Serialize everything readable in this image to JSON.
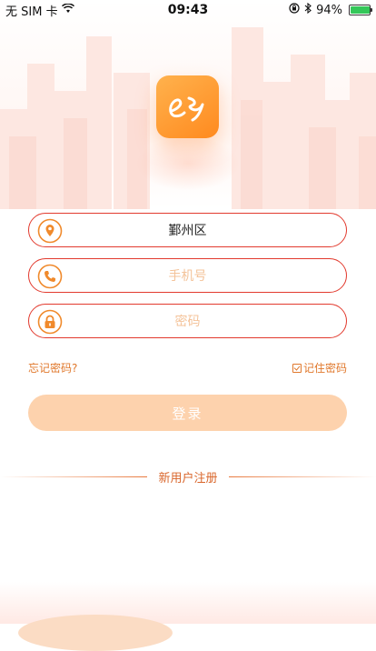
{
  "status_bar": {
    "carrier": "无 SIM 卡",
    "time": "09:43",
    "battery_percent": "94%",
    "battery_level": 0.94
  },
  "logo": {
    "icon": "app-logo-e-icon",
    "accent": "#ff9a2e"
  },
  "fields": {
    "district": {
      "value": "鄞州区",
      "icon": "location-pin-icon"
    },
    "phone": {
      "placeholder": "手机号",
      "icon": "phone-icon"
    },
    "password": {
      "placeholder": "密码",
      "icon": "lock-icon"
    }
  },
  "links": {
    "forgot_password": "忘记密码?",
    "remember_password": "记住密码",
    "remember_checked": true
  },
  "login_button": {
    "label": "登录",
    "color": "#fdd2ad"
  },
  "register": {
    "label": "新用户注册"
  },
  "colors": {
    "field_border": "#e23a2e",
    "icon_orange": "#f08a2c",
    "link_orange": "#e0782c"
  }
}
